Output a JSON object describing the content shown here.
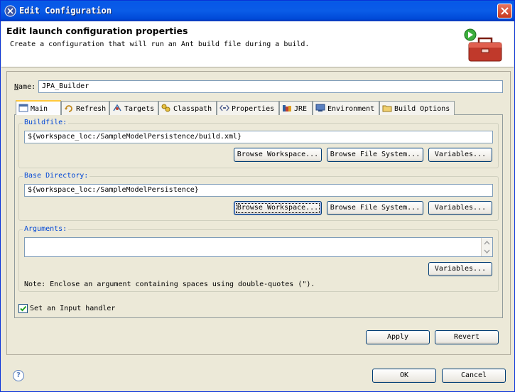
{
  "window": {
    "title": "Edit Configuration"
  },
  "banner": {
    "title": "Edit launch configuration properties",
    "message": "Create a configuration that will run an Ant build file during a build."
  },
  "name_field": {
    "label": "Name:",
    "value": "JPA_Builder"
  },
  "tabs": [
    {
      "label": "Main",
      "icon": "main-tab-icon",
      "active": true
    },
    {
      "label": "Refresh",
      "icon": "refresh-icon"
    },
    {
      "label": "Targets",
      "icon": "targets-icon"
    },
    {
      "label": "Classpath",
      "icon": "classpath-icon"
    },
    {
      "label": "Properties",
      "icon": "properties-icon"
    },
    {
      "label": "JRE",
      "icon": "jre-icon"
    },
    {
      "label": "Environment",
      "icon": "environment-icon"
    },
    {
      "label": "Build Options",
      "icon": "build-options-icon"
    }
  ],
  "buildfile": {
    "title": "Buildfile:",
    "value": "${workspace_loc:/SampleModelPersistence/build.xml}",
    "browse_workspace": "Browse Workspace...",
    "browse_file_system": "Browse File System...",
    "variables": "Variables..."
  },
  "base_directory": {
    "title": "Base Directory:",
    "value": "${workspace_loc:/SampleModelPersistence}",
    "browse_workspace": "Browse Workspace...",
    "browse_file_system": "Browse File System...",
    "variables": "Variables..."
  },
  "arguments": {
    "title": "Arguments:",
    "value": "",
    "variables": "Variables...",
    "note": "Note: Enclose an argument containing spaces using double-quotes (\")."
  },
  "input_handler": {
    "label": "Set an Input handler",
    "checked": true
  },
  "buttons": {
    "apply": "Apply",
    "revert": "Revert",
    "ok": "OK",
    "cancel": "Cancel"
  },
  "colors": {
    "titlebar": "#0054e3",
    "accent_link": "#0046d5"
  }
}
